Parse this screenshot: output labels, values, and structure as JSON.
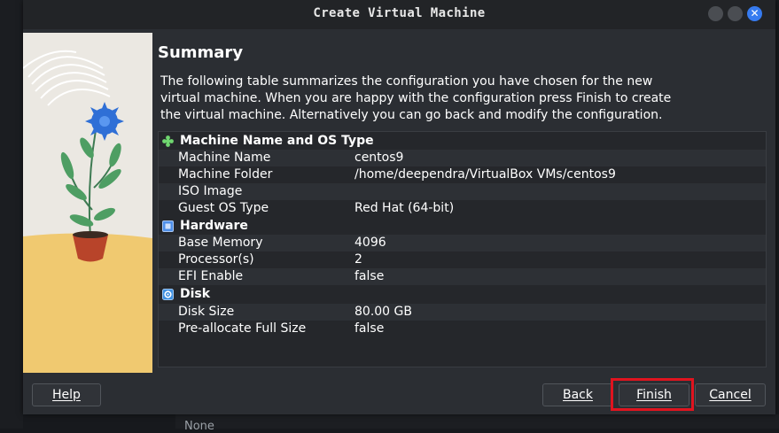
{
  "window": {
    "title": "Create Virtual Machine"
  },
  "page": {
    "heading": "Summary",
    "description": "The following table summarizes the configuration you have chosen for the new virtual machine. When you are happy with the configuration press Finish to create the virtual machine. Alternatively you can go back and modify the configuration."
  },
  "sections": {
    "general": {
      "title": "Machine Name and OS Type",
      "icon": "general-icon",
      "rows": [
        {
          "key": "Machine Name",
          "value": "centos9"
        },
        {
          "key": "Machine Folder",
          "value": "/home/deependra/VirtualBox VMs/centos9"
        },
        {
          "key": "ISO Image",
          "value": ""
        },
        {
          "key": "Guest OS Type",
          "value": "Red Hat (64-bit)"
        }
      ]
    },
    "hardware": {
      "title": "Hardware",
      "icon": "chip-icon",
      "rows": [
        {
          "key": "Base Memory",
          "value": "4096"
        },
        {
          "key": "Processor(s)",
          "value": "2"
        },
        {
          "key": "EFI Enable",
          "value": "false"
        }
      ]
    },
    "disk": {
      "title": "Disk",
      "icon": "disk-icon",
      "rows": [
        {
          "key": "Disk Size",
          "value": "80.00 GB"
        },
        {
          "key": "Pre-allocate Full Size",
          "value": "false"
        }
      ]
    }
  },
  "buttons": {
    "help": "Help",
    "back": "Back",
    "finish": "Finish",
    "cancel": "Cancel"
  },
  "background": {
    "partial_text": "None"
  },
  "colors": {
    "accent": "#367bf0",
    "highlight": "#e0141f",
    "dialog_bg": "#2b2e33"
  }
}
